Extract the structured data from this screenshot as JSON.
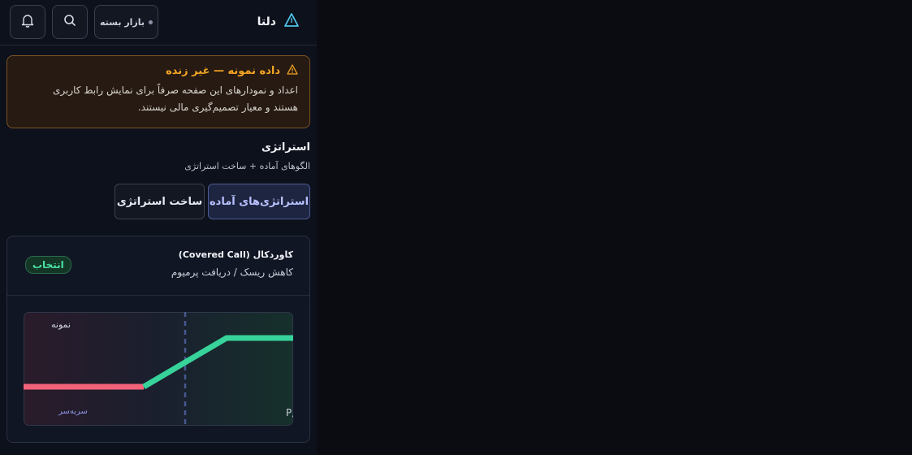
{
  "header": {
    "brand": "دلتا",
    "market_status": "بازار بسته"
  },
  "notice": {
    "title": "داده نمونه — غیر زنده",
    "body": "اعداد و نمودارهای این صفحه صرفاً برای نمایش رابط کاربری هستند و معیار تصمیم‌گیری مالی نیستند."
  },
  "section": {
    "title": "استراتژی",
    "subtitle": "الگوهای آماده + ساخت استراتژی"
  },
  "tabs": {
    "ready": "استراتژی‌های آماده",
    "build": "ساخت استراتژی"
  },
  "card": {
    "title": "کاوردکال (Covered Call)",
    "subtitle": "کاهش ریسک / دریافت پرمیوم",
    "select_label": "انتخاب"
  },
  "chart": {
    "sample_label": "نمونه",
    "breakeven_label": "سربه‌سر",
    "pl_label": "P/L"
  },
  "colors": {
    "accent": "#49e1a3",
    "loss": "#f2637a",
    "warning": "#f5a524",
    "brand_icon": "#4fc3e8"
  }
}
